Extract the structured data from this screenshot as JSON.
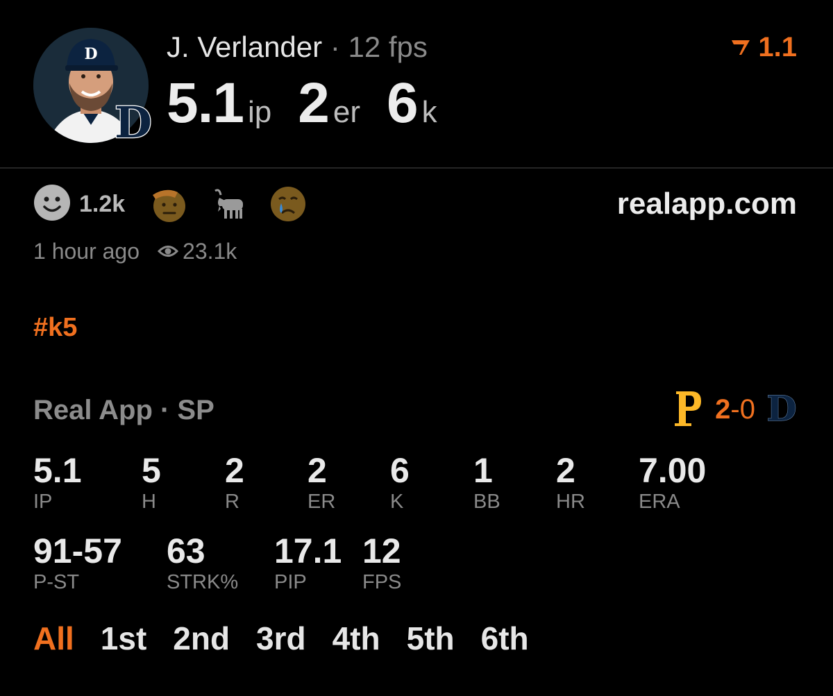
{
  "header": {
    "player_name": "J. Verlander",
    "separator": "·",
    "fps": "12 fps",
    "summary": [
      {
        "value": "5.1",
        "unit": "ip"
      },
      {
        "value": "2",
        "unit": "er"
      },
      {
        "value": "6",
        "unit": "k"
      }
    ],
    "rating": "1.1",
    "rating_icon": "rating-chevron-icon",
    "team_badge_icon": "tigers-d-logo-icon"
  },
  "reactions": {
    "like_count": "1.2k",
    "emojis": [
      "saluting-face-emoji",
      "goat-emoji",
      "sad-face-emoji"
    ]
  },
  "site": "realapp.com",
  "meta": {
    "time": "1 hour ago",
    "views": "23.1k"
  },
  "hashtag": "#k5",
  "game": {
    "source": "Real App · SP",
    "score_home": "2",
    "score_dash": "-",
    "score_away": "0",
    "home_team_icon": "pirates-p-logo-icon",
    "away_team_icon": "tigers-d-logo-icon"
  },
  "stats_row1": [
    {
      "value": "5.1",
      "label": "IP"
    },
    {
      "value": "5",
      "label": "H"
    },
    {
      "value": "2",
      "label": "R"
    },
    {
      "value": "2",
      "label": "ER"
    },
    {
      "value": "6",
      "label": "K"
    },
    {
      "value": "1",
      "label": "BB"
    },
    {
      "value": "2",
      "label": "HR"
    },
    {
      "value": "7.00",
      "label": "ERA"
    }
  ],
  "stats_row2": [
    {
      "value": "91-57",
      "label": "P-ST"
    },
    {
      "value": "63",
      "label": "STRK%"
    },
    {
      "value": "17.1",
      "label": "PIP"
    },
    {
      "value": "12",
      "label": "FPS"
    }
  ],
  "tabs": [
    "All",
    "1st",
    "2nd",
    "3rd",
    "4th",
    "5th",
    "6th"
  ],
  "active_tab": "All",
  "colors": {
    "accent": "#f0701f",
    "pirates_gold": "#fdb827",
    "tigers_navy": "#0c2340"
  }
}
